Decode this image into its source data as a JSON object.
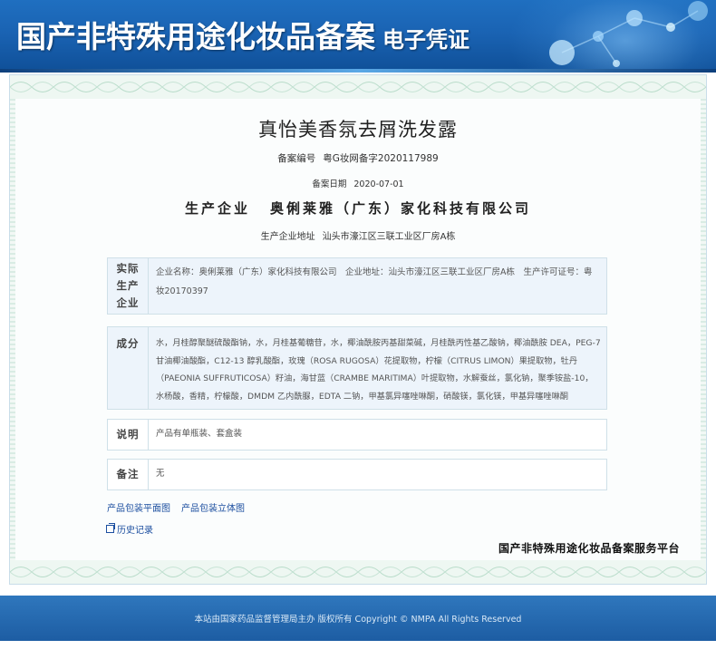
{
  "banner": {
    "title": "国产非特殊用途化妆品备案",
    "subtitle": "电子凭证"
  },
  "product": {
    "name": "真怡美香氛去屑洗发露",
    "registration_label": "备案编号",
    "registration_number": "粤G妆网备字2020117989",
    "date_label": "备案日期",
    "date": "2020-07-01",
    "company_label": "生产企业",
    "company": "奥俐莱雅（广东）家化科技有限公司",
    "address_label": "生产企业地址",
    "address": "汕头市濠江区三联工业区厂房A栋"
  },
  "actual_producer": {
    "label": "实际生产企业",
    "text": "企业名称：奥俐莱雅（广东）家化科技有限公司　企业地址：汕头市濠江区三联工业区厂房A栋　生产许可证号：粤妆20170397"
  },
  "ingredients": {
    "label": "成分",
    "text": "水，月桂醇聚醚硫酸酯钠，水，月桂基葡糖苷，水，椰油酰胺丙基甜菜碱，月桂酰丙性基乙酸钠，椰油酰胺 DEA，PEG-7 甘油椰油酸酯，C12-13 醇乳酸酯，玫瑰（ROSA RUGOSA）花提取物，柠檬（CITRUS LIMON）果提取物，牡丹（PAEONIA SUFFRUTICOSA）籽油，海甘蓝（CRAMBE MARITIMA）叶提取物，水解蚕丝，氯化钠，聚季铵盐-10，水杨酸，香精，柠檬酸，DMDM 乙内酰脲，EDTA 二钠，甲基氯异噻唑啉酮，硝酸镁，氯化镁，甲基异噻唑啉酮"
  },
  "description": {
    "label": "说明",
    "text": "产品有单瓶装、套盒装"
  },
  "remark": {
    "label": "备注",
    "text": "无"
  },
  "links": {
    "flat_image": "产品包装平面图",
    "stereo_image": "产品包装立体图",
    "history": "历史记录"
  },
  "platform_name": "国产非特殊用途化妆品备案服务平台",
  "footer": {
    "copyright": "本站由国家药品监督管理局主办 版权所有 Copyright © NMPA All Rights Reserved"
  }
}
